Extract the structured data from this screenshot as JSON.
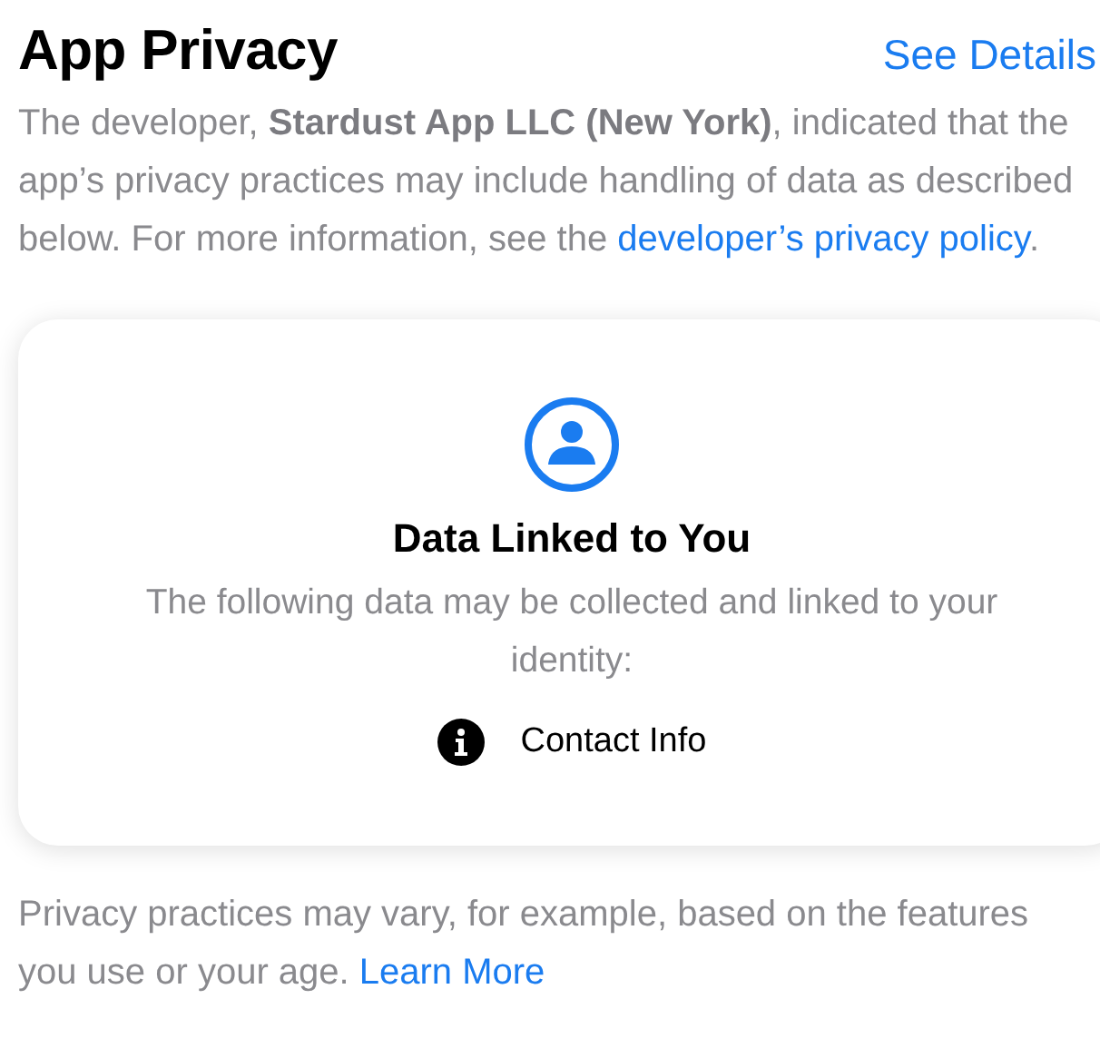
{
  "header": {
    "title": "App Privacy",
    "action": "See Details"
  },
  "intro": {
    "text": "The developer, **Stardust App LLC (New York)**, indicated that the app’s privacy practices may include handling of data as described below. For more information, see the ",
    "link": "developer’s privacy policy",
    "after": "."
  },
  "card": {
    "title": "Data Linked to You",
    "description": "The following data may be collected and linked to your identity:",
    "items": [
      {
        "kind": "info",
        "label": "Contact Info"
      }
    ]
  },
  "footer": {
    "text": "Privacy practices may vary, for example, based on the features you use or your age. ",
    "link": "Learn More"
  }
}
